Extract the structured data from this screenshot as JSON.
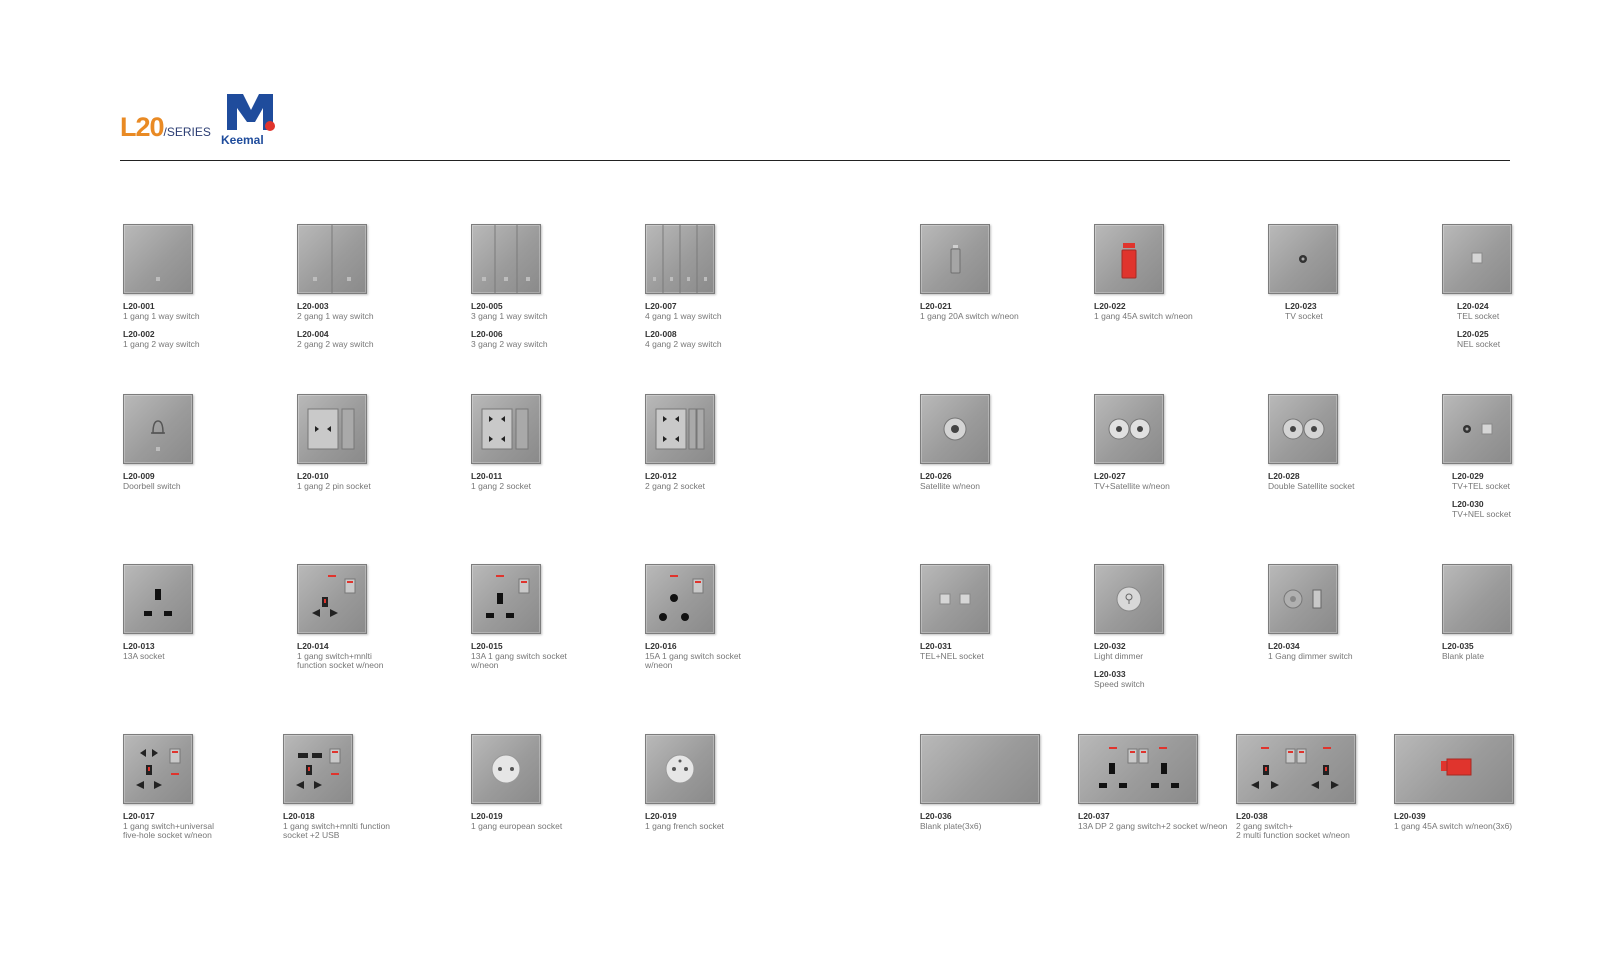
{
  "header": {
    "series": "L20",
    "series_suffix": "/SERIES",
    "brand": "Keemal"
  },
  "colors": {
    "accent_orange": "#e98a24",
    "brand_blue": "#1f4c9c",
    "neon_red": "#e0342d",
    "tile_gray": "#9b9b9b"
  },
  "products": {
    "p001": {
      "code": "L20-001",
      "desc": "1 gang 1 way switch"
    },
    "p002": {
      "code": "L20-002",
      "desc": "1 gang 2 way switch"
    },
    "p003": {
      "code": "L20-003",
      "desc": "2 gang 1 way switch"
    },
    "p004": {
      "code": "L20-004",
      "desc": "2 gang 2 way switch"
    },
    "p005": {
      "code": "L20-005",
      "desc": "3 gang 1 way switch"
    },
    "p006": {
      "code": "L20-006",
      "desc": "3 gang 2 way switch"
    },
    "p007": {
      "code": "L20-007",
      "desc": "4 gang 1 way switch"
    },
    "p008": {
      "code": "L20-008",
      "desc": "4 gang 2 way switch"
    },
    "p021": {
      "code": "L20-021",
      "desc": "1 gang 20A switch w/neon"
    },
    "p022": {
      "code": "L20-022",
      "desc": "1 gang 45A switch w/neon"
    },
    "p023": {
      "code": "L20-023",
      "desc": "TV socket"
    },
    "p024": {
      "code": "L20-024",
      "desc": "TEL socket"
    },
    "p025": {
      "code": "L20-025",
      "desc": "NEL socket"
    },
    "p009": {
      "code": "L20-009",
      "desc": "Doorbell switch"
    },
    "p010": {
      "code": "L20-010",
      "desc": "1 gang 2 pin socket"
    },
    "p011": {
      "code": "L20-011",
      "desc": "1 gang 2 socket"
    },
    "p012": {
      "code": "L20-012",
      "desc": "2 gang 2 socket"
    },
    "p026": {
      "code": "L20-026",
      "desc": "Satellite w/neon"
    },
    "p027": {
      "code": "L20-027",
      "desc": "TV+Satellite w/neon"
    },
    "p028": {
      "code": "L20-028",
      "desc": "Double Satellite socket"
    },
    "p029": {
      "code": "L20-029",
      "desc": "TV+TEL socket"
    },
    "p030": {
      "code": "L20-030",
      "desc": "TV+NEL socket"
    },
    "p013": {
      "code": "L20-013",
      "desc": "13A socket"
    },
    "p014": {
      "code": "L20-014",
      "desc1": "1 gang switch+mnlti",
      "desc2": "function socket w/neon"
    },
    "p015": {
      "code": "L20-015",
      "desc1": "13A 1 gang switch socket",
      "desc2": "w/neon"
    },
    "p016": {
      "code": "L20-016",
      "desc1": "15A 1 gang switch socket",
      "desc2": "w/neon"
    },
    "p031": {
      "code": "L20-031",
      "desc": "TEL+NEL socket"
    },
    "p032": {
      "code": "L20-032",
      "desc": "Light dimmer"
    },
    "p033": {
      "code": "L20-033",
      "desc": "Speed switch"
    },
    "p034": {
      "code": "L20-034",
      "desc": "1 Gang dimmer switch"
    },
    "p035": {
      "code": "L20-035",
      "desc": "Blank plate"
    },
    "p017": {
      "code": "L20-017",
      "desc1": "1 gang switch+universal",
      "desc2": "five-hole socket w/neon"
    },
    "p018": {
      "code": "L20-018",
      "desc1": "1 gang switch+mnlti function",
      "desc2": "socket +2 USB"
    },
    "p019a": {
      "code": "L20-019",
      "desc": "1 gang european socket"
    },
    "p019b": {
      "code": "L20-019",
      "desc": "1 gang french socket"
    },
    "p036": {
      "code": "L20-036",
      "desc": "Blank plate(3x6)"
    },
    "p037": {
      "code": "L20-037",
      "desc": "13A DP 2 gang switch+2 socket w/neon"
    },
    "p038": {
      "code": "L20-038",
      "desc1": "2 gang switch+",
      "desc2": "2 multi function socket w/neon"
    },
    "p039": {
      "code": "L20-039",
      "desc": "1 gang 45A switch w/neon(3x6)"
    }
  }
}
